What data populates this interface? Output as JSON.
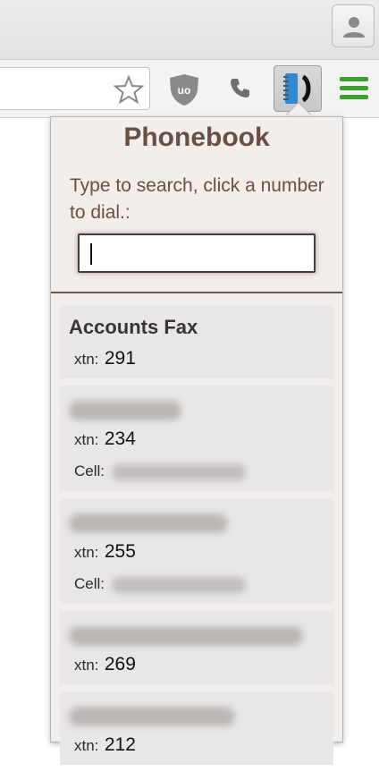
{
  "popup": {
    "title": "Phonebook",
    "instructions": "Type to search, click a number to dial.:",
    "search": {
      "value": "",
      "placeholder": ""
    }
  },
  "contacts": [
    {
      "name": "Accounts Fax",
      "xtn_label": "xtn:",
      "xtn": "291"
    },
    {
      "name": "",
      "xtn_label": "xtn:",
      "xtn": "234",
      "cell_label": "Cell:"
    },
    {
      "name": "",
      "xtn_label": "xtn:",
      "xtn": "255",
      "cell_label": "Cell:"
    },
    {
      "name": "",
      "xtn_label": "xtn:",
      "xtn": "269"
    },
    {
      "name": "",
      "xtn_label": "xtn:",
      "xtn": "212"
    }
  ],
  "colors": {
    "title": "#6b4f45",
    "popup_bg": "#f2eeec",
    "card_bg": "#e8e6e7",
    "menu_green": "#3aa02c"
  },
  "icons": [
    "profile-icon",
    "star-icon",
    "ublock-icon",
    "phone-icon",
    "phonebook-extension-icon",
    "menu-icon"
  ]
}
